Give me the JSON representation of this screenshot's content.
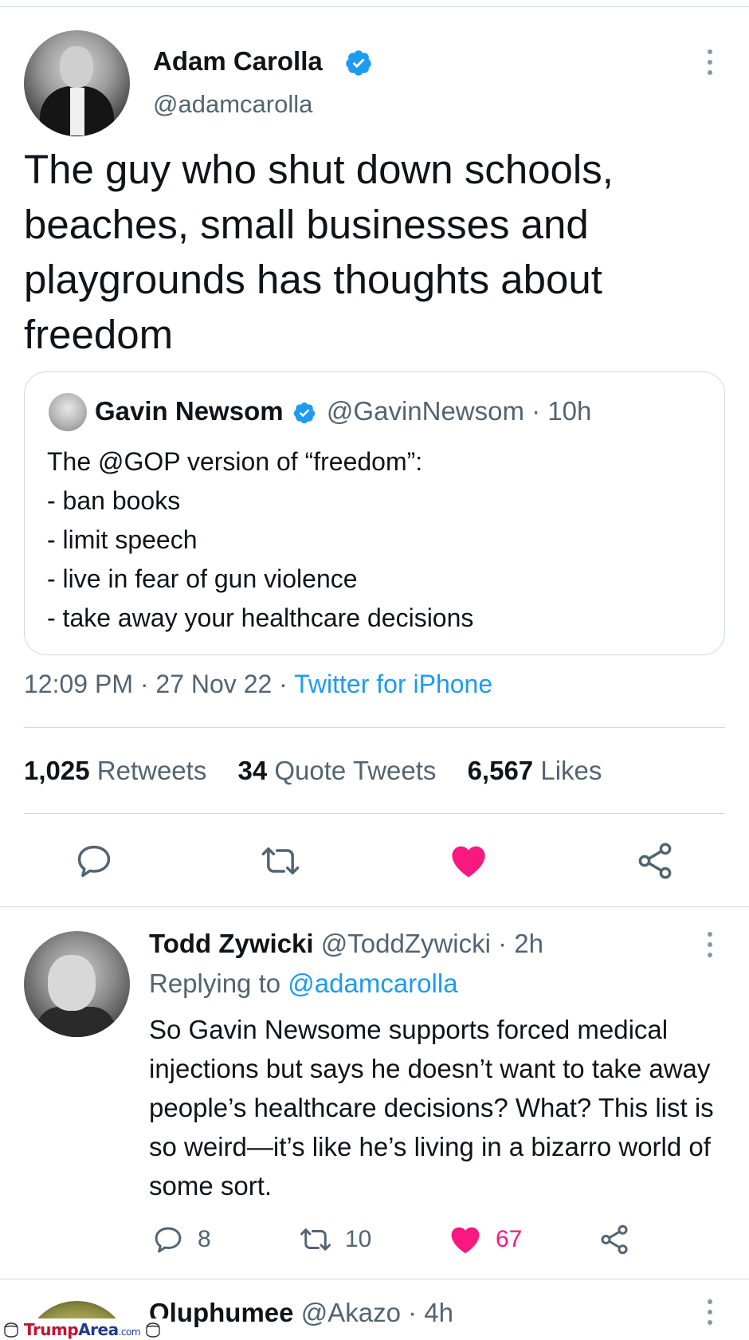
{
  "main_tweet": {
    "author_name": "Adam Carolla",
    "author_handle": "@adamcarolla",
    "text": "The guy who shut down schools, beaches, small businesses and playgrounds has thoughts about freedom",
    "timestamp": "12:09 PM · 27 Nov 22 · ",
    "source": "Twitter for iPhone",
    "stats": {
      "retweets_count": "1,025",
      "retweets_label": "Retweets",
      "quotes_count": "34",
      "quotes_label": "Quote Tweets",
      "likes_count": "6,567",
      "likes_label": "Likes"
    }
  },
  "quoted_tweet": {
    "author_name": "Gavin Newsom",
    "author_handle": "@GavinNewsom · 10h",
    "lines": [
      "The @GOP version of “freedom”:",
      "- ban books",
      "- limit speech",
      "- live in fear of gun violence",
      "- take away your healthcare decisions"
    ]
  },
  "reply": {
    "author_name": "Todd Zywicki",
    "meta": "@ToddZywicki · 2h",
    "replying_prefix": "Replying to",
    "replying_mention": "@adamcarolla",
    "text": "So Gavin Newsome supports forced medical injections but says he doesn’t want to take away people’s healthcare decisions? What? This list is so weird—it’s like he’s living in a bizarro world of some sort.",
    "reply_count": "8",
    "retweet_count": "10",
    "like_count": "67"
  },
  "next_reply": {
    "author_name": "Oluphumee",
    "meta": "@Akazo · 4h"
  },
  "watermark": {
    "part1": "Trump",
    "part2": "Area",
    "part3": ".com"
  },
  "colors": {
    "accent_blue": "#1d9bf0",
    "like_pink": "#f91880",
    "muted_text": "#536471"
  },
  "icons": [
    "verified-badge-icon",
    "more-options-icon",
    "reply-icon",
    "retweet-icon",
    "like-heart-icon",
    "share-icon"
  ]
}
